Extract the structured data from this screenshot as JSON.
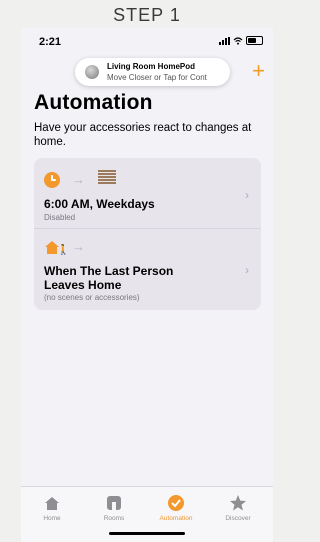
{
  "caption": "STEP 1",
  "status_bar": {
    "time": "2:21"
  },
  "homepod": {
    "title": "Living Room HomePod",
    "subtitle": "Move Closer or Tap for Cont"
  },
  "header": {
    "add_icon": "plus-icon",
    "title": "Automation",
    "description": "Have your accessories react to changes at home."
  },
  "automations": [
    {
      "title": "6:00 AM, Weekdays",
      "subtitle": "Disabled",
      "trigger_icon": "clock-icon",
      "target_icon": "blinds-icon"
    },
    {
      "title": "When The Last Person Leaves Home",
      "subtitle": "(no scenes or accessories)",
      "trigger_icon": "house-person-icon"
    }
  ],
  "tabs": [
    {
      "label": "Home",
      "icon": "house-icon"
    },
    {
      "label": "Rooms",
      "icon": "rooms-icon"
    },
    {
      "label": "Automation",
      "icon": "automation-icon",
      "active": true
    },
    {
      "label": "Discover",
      "icon": "star-icon"
    }
  ],
  "colors": {
    "accent": "#f2982d",
    "background": "#f3f2f7",
    "card": "#e8e4ec"
  }
}
